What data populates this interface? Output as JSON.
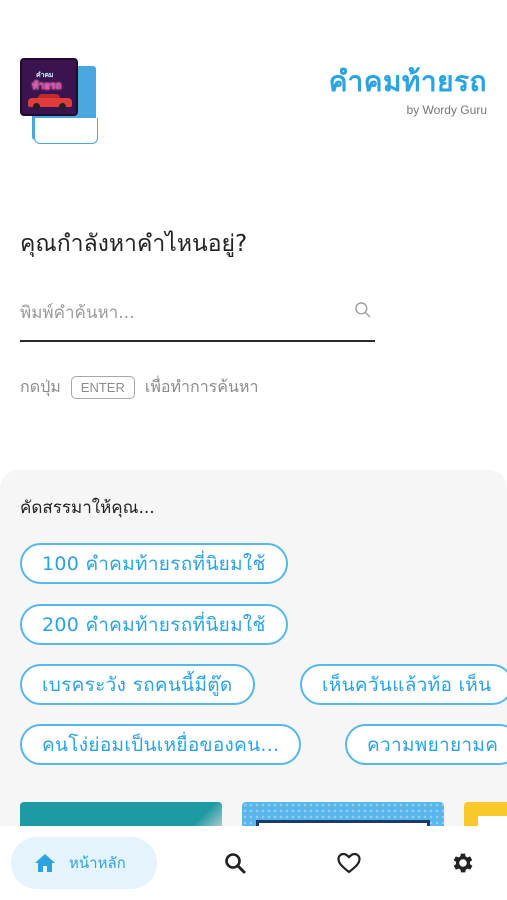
{
  "header": {
    "logo_lines": [
      "คำคม",
      "ท้ายรถ"
    ],
    "title": "คำคมท้ายรถ",
    "subtitle": "by Wordy Guru"
  },
  "search": {
    "question": "คุณกำลังหาคำไหนอยู่?",
    "placeholder": "พิมพ์คำค้นหา...",
    "value": "",
    "hint_prefix": "กดปุ่ม",
    "hint_key": "ENTER",
    "hint_suffix": "เพื่อทำการค้นหา"
  },
  "recommend": {
    "title": "คัดสรรมาให้คุณ...",
    "chips": [
      "100 คำคมท้ายรถที่นิยมใช้",
      "200 คำคมท้ายรถที่นิยมใช้",
      "เบรคระวัง รถคนนี้มีตู๊ด",
      "เห็นควันแล้วท้อ เห็น",
      "คนโง่ย่อมเป็นเหยื่อของคน...",
      "ความพยายามค"
    ]
  },
  "nav": {
    "home_label": "หน้าหลัก",
    "home_icon": "home-icon",
    "search_icon": "search-icon",
    "favorites_icon": "heart-icon",
    "settings_icon": "gear-icon"
  },
  "colors": {
    "accent": "#2aa3e3",
    "chip_border": "#56b7ea",
    "panel_bg": "#f6f6f6",
    "nav_active_bg": "#e5f3fc"
  }
}
